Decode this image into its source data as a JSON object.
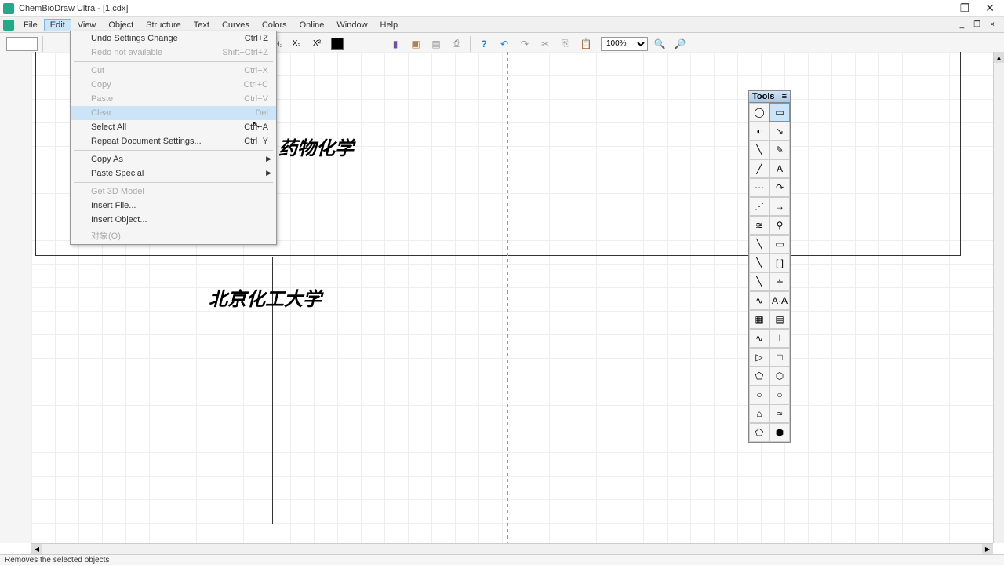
{
  "title": "ChemBioDraw Ultra - [1.cdx]",
  "menus": [
    "File",
    "Edit",
    "View",
    "Object",
    "Structure",
    "Text",
    "Curves",
    "Colors",
    "Online",
    "Window",
    "Help"
  ],
  "active_menu": 1,
  "edit_menu": [
    {
      "label": "Undo Settings Change",
      "shortcut": "Ctrl+Z",
      "enabled": true
    },
    {
      "label": "Redo not available",
      "shortcut": "Shift+Ctrl+Z",
      "enabled": false
    },
    {
      "sep": true
    },
    {
      "label": "Cut",
      "shortcut": "Ctrl+X",
      "enabled": false
    },
    {
      "label": "Copy",
      "shortcut": "Ctrl+C",
      "enabled": false
    },
    {
      "label": "Paste",
      "shortcut": "Ctrl+V",
      "enabled": false
    },
    {
      "label": "Clear",
      "shortcut": "Del",
      "enabled": false,
      "hover": true
    },
    {
      "label": "Select All",
      "shortcut": "Ctrl+A",
      "enabled": true
    },
    {
      "label": "Repeat Document Settings...",
      "shortcut": "Ctrl+Y",
      "enabled": true
    },
    {
      "sep": true
    },
    {
      "label": "Copy As",
      "submenu": true,
      "enabled": true
    },
    {
      "label": "Paste Special",
      "submenu": true,
      "enabled": true
    },
    {
      "sep": true
    },
    {
      "label": "Get 3D Model",
      "enabled": false
    },
    {
      "label": "Insert File...",
      "enabled": true
    },
    {
      "label": "Insert Object...",
      "enabled": true
    },
    {
      "label": "对象(O)",
      "enabled": false
    }
  ],
  "toolbar": {
    "zoom": "100%"
  },
  "canvas": {
    "text1": "药物化学",
    "text2": "北京化工大学"
  },
  "tools_title": "Tools",
  "tool_icons": [
    "◯",
    "▭",
    "◐",
    "↘",
    "╲",
    "✎",
    "╱",
    "A",
    "⋯",
    "↷",
    "⋰",
    "→",
    "≋",
    "⚲",
    "╲",
    "▭",
    "╲",
    "[ ]",
    "╲",
    "∸",
    "∿",
    "A·A",
    "▦",
    "▤",
    "∿",
    "⊥",
    "▷",
    "□",
    "⬠",
    "⬡",
    "○",
    "○",
    "⌂",
    "≈",
    "⬠",
    "⬢"
  ],
  "selected_tool": 1,
  "status": "Removes the selected objects",
  "window_controls": {
    "min": "—",
    "max": "❐",
    "close": "✕"
  },
  "mdi_controls": {
    "min": "_",
    "max": "❐",
    "close": "×"
  }
}
